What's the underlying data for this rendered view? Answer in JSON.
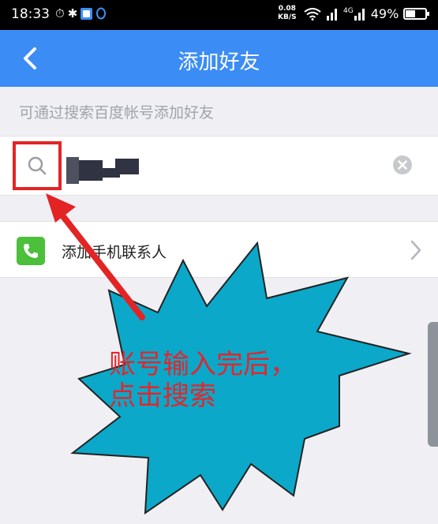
{
  "status_bar": {
    "time": "18:33",
    "speed_value": "0.08",
    "speed_unit": "KB/S",
    "network": "4G",
    "battery": "49%",
    "battery_level": 0.49
  },
  "header": {
    "title": "添加好友",
    "back_icon": "chevron-left-icon"
  },
  "hint": "可通过搜索百度帐号添加好友",
  "search": {
    "value": "",
    "icon": "search-icon",
    "clear_icon": "clear-icon"
  },
  "contacts": {
    "label": "添加手机联系人",
    "icon": "phone-icon",
    "chevron": "chevron-right-icon"
  },
  "annotation": {
    "line1": "账号输入完后，",
    "line2": "点击搜索"
  },
  "colors": {
    "accent": "#3b8cf5",
    "annotation_red": "#e32424",
    "callout_fill": "#0ba8c9",
    "phone_green": "#4cbf3b"
  }
}
